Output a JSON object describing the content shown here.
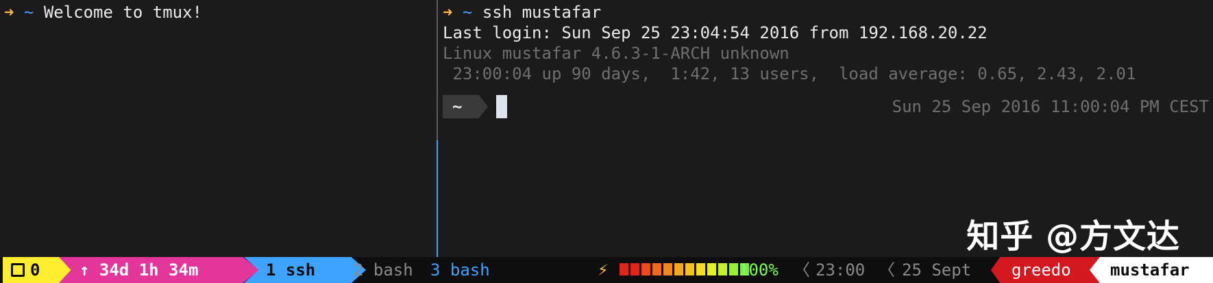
{
  "left_pane": {
    "arrow": "➜",
    "dir": "~",
    "text": "Welcome to tmux!"
  },
  "right_pane": {
    "arrow": "➜",
    "dir": "~",
    "command": "ssh mustafar",
    "last_login": "Last login: Sun Sep 25 23:04:54 2016 from 192.168.20.22",
    "uname": "Linux mustafar 4.6.3-1-ARCH unknown",
    "uptime": " 23:00:04 up 90 days,  1:42, 13 users,  load average: 0.65, 2.43, 2.01",
    "prompt_dir": "~",
    "right_prompt": "Sun 25 Sep 2016 11:00:04 PM CEST"
  },
  "status_bar": {
    "session_icon": "window-icon",
    "session": "0",
    "uptime_arrow": "↑",
    "uptime": "34d 1h 34m",
    "windows": [
      {
        "label": "1 ssh",
        "active": true
      },
      {
        "label": "2 bash",
        "active": false
      },
      {
        "label": "3 bash",
        "active": false
      }
    ],
    "bolt": "⚡",
    "battery_level": 1.0,
    "battery_colors": [
      "#e1261c",
      "#e1261c",
      "#ef4a1c",
      "#f06a1e",
      "#f0881e",
      "#f2a91f",
      "#f5c320",
      "#f4dd22",
      "#e2f028",
      "#c4f02d",
      "#9af035",
      "#7ee84a"
    ],
    "battery_text": "100%",
    "separator": "〈",
    "time": "23:00",
    "date": "25 Sept",
    "user": "greedo",
    "host": "mustafar"
  },
  "watermark": "知乎 @方文达",
  "colors": {
    "accent_blue": "#3ea3ff",
    "arrow_orange": "#ffb84a",
    "session_yellow": "#ffee2f",
    "uptime_pink": "#e4359b",
    "user_red": "#d4181f"
  }
}
